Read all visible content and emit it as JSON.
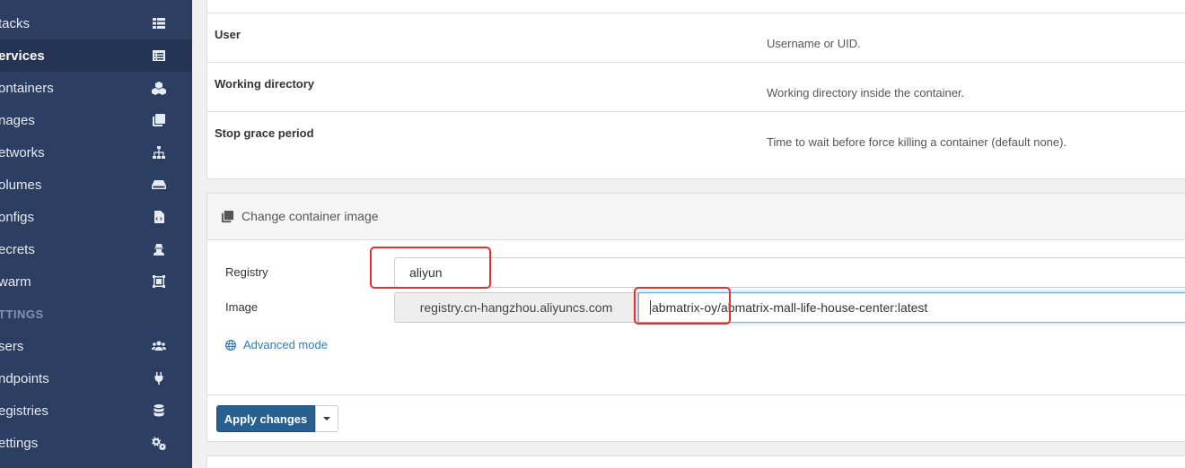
{
  "sidebar": {
    "items": [
      {
        "label": "tacks",
        "icon": "th-list-icon"
      },
      {
        "label": "ervices",
        "icon": "list-alt-icon",
        "active": true
      },
      {
        "label": "ontainers",
        "icon": "cubes-icon"
      },
      {
        "label": "nages",
        "icon": "clone-icon"
      },
      {
        "label": "etworks",
        "icon": "sitemap-icon"
      },
      {
        "label": "olumes",
        "icon": "hdd-icon"
      },
      {
        "label": "onfigs",
        "icon": "file-code-icon"
      },
      {
        "label": "ecrets",
        "icon": "user-secret-icon"
      },
      {
        "label": "warm",
        "icon": "object-group-icon"
      }
    ],
    "settings_heading": "TTINGS",
    "settings_items": [
      {
        "label": "sers",
        "icon": "users-icon"
      },
      {
        "label": "ndpoints",
        "icon": "plug-icon"
      },
      {
        "label": "egistries",
        "icon": "database-icon"
      },
      {
        "label": "ettings",
        "icon": "cogs-icon"
      }
    ]
  },
  "config_rows": [
    {
      "label": "User",
      "help": "Username or UID."
    },
    {
      "label": "Working directory",
      "help": "Working directory inside the container."
    },
    {
      "label": "Stop grace period",
      "help": "Time to wait before force killing a container (default none)."
    }
  ],
  "image_panel": {
    "title": "Change container image",
    "icon": "clone-icon",
    "registry_label": "Registry",
    "registry_value": "aliyun",
    "image_label": "Image",
    "image_prefix": "registry.cn-hangzhou.aliyuncs.com",
    "image_value": "abmatrix-oy/abmatrix-mall-life-house-center:latest",
    "advanced_mode": "Advanced mode",
    "apply_label": "Apply changes"
  },
  "colors": {
    "sidebar_bg": "#2d3e63",
    "primary_button": "#286090",
    "link": "#337ab7",
    "annotation": "#e8302b"
  }
}
